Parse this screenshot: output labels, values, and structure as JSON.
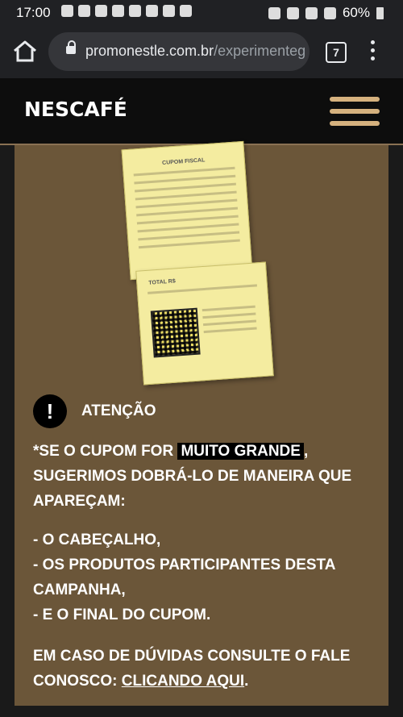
{
  "status": {
    "time": "17:00",
    "battery": "60%"
  },
  "browser": {
    "url_host": "promonestle.com.br",
    "url_path": "/experimenteg",
    "tab_count": "7"
  },
  "site": {
    "logo": "NESCAFÉ"
  },
  "notice": {
    "title": "ATENÇÃO",
    "icon_symbol": "!",
    "line1_prefix": "*SE O CUPOM FOR",
    "line1_highlight": "MUITO GRANDE",
    "line1_suffix": ",",
    "line1_rest": "SUGERIMOS DOBRÁ-LO DE MANEIRA QUE APAREÇAM:",
    "items": [
      "- O CABEÇALHO,",
      "- OS PRODUTOS PARTICIPANTES DESTA CAMPANHA,",
      "- E O FINAL DO CUPOM."
    ],
    "contact_prefix": "EM CASO DE DÚVIDAS CONSULTE O FALE CONOSCO:",
    "contact_link": "CLICANDO AQUI",
    "contact_suffix": "."
  },
  "receipt": {
    "title": "CUPOM FISCAL",
    "total": "TOTAL R$"
  }
}
